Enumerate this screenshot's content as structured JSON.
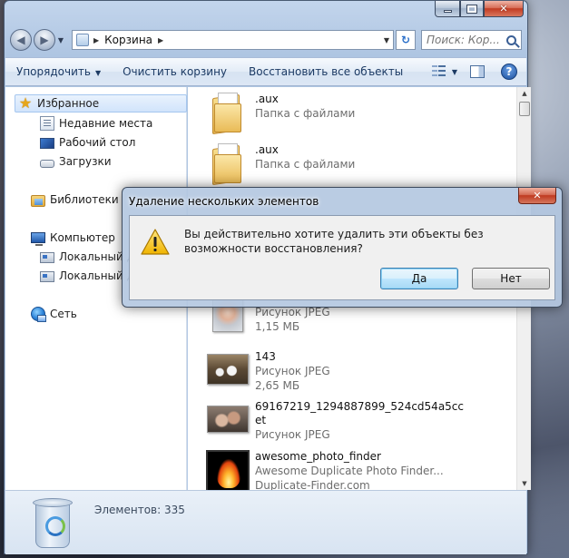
{
  "window": {
    "controls": {
      "minimize": "",
      "maximize": "",
      "close": "✕"
    }
  },
  "address": {
    "back_icon": "◀",
    "forward_icon": "▶",
    "path": "Корзина",
    "refresh_icon": "↻",
    "search_placeholder": "Поиск: Кор..."
  },
  "toolbar": {
    "organize": "Упорядочить",
    "empty_bin": "Очистить корзину",
    "restore_all": "Восстановить все объекты"
  },
  "nav": {
    "favorites": "Избранное",
    "recent": "Недавние места",
    "desktop": "Рабочий стол",
    "downloads": "Загрузки",
    "libraries": "Библиотеки",
    "computer": "Компьютер",
    "local_disk_1": "Локальный д",
    "local_disk_2": "Локальный д",
    "network": "Сеть"
  },
  "files": [
    {
      "name": ".aux",
      "type": "Папка с файлами",
      "size": ""
    },
    {
      "name": ".aux",
      "type": "Папка с файлами",
      "size": ""
    },
    {
      "name": "",
      "type": "Рисунок JPEG",
      "size": "1,15 МБ"
    },
    {
      "name": "143",
      "type": "Рисунок JPEG",
      "size": "2,65 МБ"
    },
    {
      "name": "69167219_1294887899_524cd54a5cc",
      "name2": "et",
      "type": "Рисунок JPEG",
      "size": ""
    },
    {
      "name": "awesome_photo_finder",
      "type": "Awesome Duplicate Photo Finder...",
      "size": "Duplicate-Finder.com"
    }
  ],
  "details": {
    "items_count": "Элементов: 335"
  },
  "dialog": {
    "title": "Удаление нескольких элементов",
    "close": "✕",
    "message": "Вы действительно хотите удалить эти объекты без возможности восстановления?",
    "yes": "Да",
    "no": "Нет"
  },
  "colors": {
    "accent": "#1c3a64",
    "selection": "#d1e4fb",
    "close_red": "#c23b22"
  }
}
